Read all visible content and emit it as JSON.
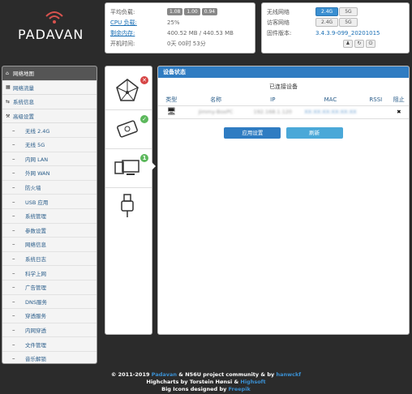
{
  "brand": {
    "name": "PADAVAN"
  },
  "stats": {
    "load_label": "平均负载:",
    "load_values": [
      "1.08",
      "1.00",
      "0.94"
    ],
    "cpu_label": "CPU 负载:",
    "cpu_value": "25%",
    "mem_label": "剩余内存:",
    "mem_value": "400.52 MB / 440.53 MB",
    "uptime_label": "开机时间:",
    "uptime_value": "0天 00时 53分"
  },
  "wireless": {
    "wifi_label": "无线网络",
    "guest_label": "访客网络",
    "fw_label": "固件版本:",
    "fw_value": "3.4.3.9-099_20201015",
    "btn_24": "2.4G",
    "btn_5": "5G"
  },
  "sidebar": {
    "items": [
      {
        "label": "网络地图",
        "icon": "home-icon",
        "active": true
      },
      {
        "label": "网络流量",
        "icon": "grid-icon"
      },
      {
        "label": "系统信息",
        "icon": "shuffle-icon"
      },
      {
        "label": "高级设置",
        "icon": "wrench-icon"
      }
    ],
    "subitems": [
      "无线 2.4G",
      "无线 5G",
      "内网 LAN",
      "外网 WAN",
      "防火墙",
      "USB 应用",
      "系统管理",
      "参数设置",
      "网络信息",
      "系统日志",
      "科学上网",
      "广告管理",
      "DNS服务",
      "穿透服务",
      "内网穿透",
      "文件管理",
      "音乐解锁"
    ]
  },
  "status_panel": {
    "title": "设备状态",
    "subtitle": "已连接设备",
    "columns": [
      "类型",
      "名称",
      "IP",
      "MAC",
      "RSSI",
      "阻止"
    ],
    "rows": [
      {
        "name": "Jimmy-BoxPC",
        "ip": "192.168.1.120",
        "mac": "XX:XX:XX:XX:XX:XX",
        "rssi": "",
        "block": "✖"
      }
    ],
    "apply_label": "应用设置",
    "refresh_label": "刷新"
  },
  "footer": {
    "line1_pre": "© 2011-2019 ",
    "line1_link1": "Padavan",
    "line1_mid": " & N56U project community & by ",
    "line1_link2": "hanwckf",
    "line2_pre": "Highcharts by Torstein Hønsi & ",
    "line2_link": "Highsoft",
    "line3_pre": "Big Icons designed by ",
    "line3_link": "Freepik"
  },
  "colors": {
    "accent": "#2f7cc2",
    "background": "#2b2b2b",
    "error": "#d64545",
    "ok": "#5cb85c"
  }
}
